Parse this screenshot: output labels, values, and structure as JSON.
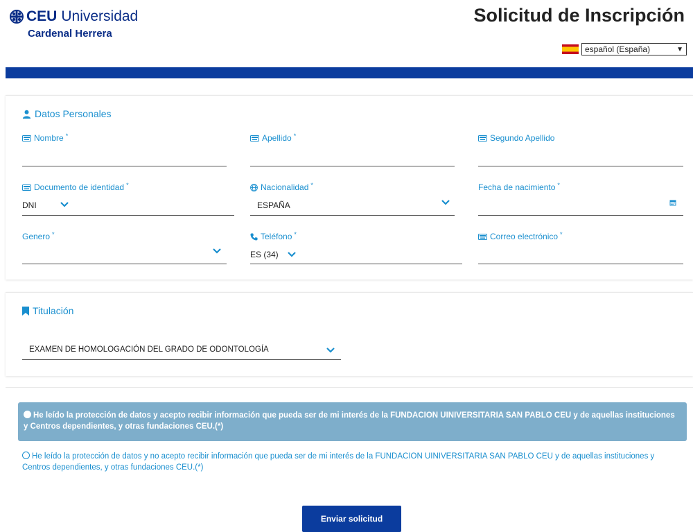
{
  "header": {
    "logo_ceu": "CEU",
    "logo_universidad": "Universidad",
    "logo_subtitle": "Cardenal Herrera",
    "title": "Solicitud de Inscripción",
    "language": "español (España)"
  },
  "personal": {
    "section_title": "Datos Personales",
    "nombre_label": "Nombre",
    "apellido_label": "Apellido",
    "segundo_apellido_label": "Segundo Apellido",
    "documento_label": "Documento de identidad",
    "documento_value": "DNI",
    "nacionalidad_label": "Nacionalidad",
    "nacionalidad_value": "ESPAÑA",
    "fecha_label": "Fecha de nacimiento",
    "genero_label": "Genero",
    "telefono_label": "Teléfono",
    "telefono_prefix": "ES (34)",
    "correo_label": "Correo electrónico",
    "required_mark": "*"
  },
  "titulacion": {
    "section_title": "Titulación",
    "value": "EXAMEN DE HOMOLOGACIÓN DEL GRADO DE ODONTOLOGÍA"
  },
  "consent": {
    "accept_text": "He leído la protección de datos y acepto recibir información que pueda ser de mi interés de la FUNDACION UINIVERSITARIA SAN PABLO CEU y de aquellas instituciones y Centros dependientes, y otras fundaciones CEU.(*)",
    "reject_text": "He leído la protección de datos y no acepto recibir información que pueda ser de mi interés de la FUNDACION UINIVERSITARIA SAN PABLO CEU y de aquellas instituciones y Centros dependientes, y otras fundaciones CEU.(*)"
  },
  "submit_label": "Enviar solicitud",
  "colors": {
    "brand_blue": "#0b3c9e",
    "accent": "#1a8fcf",
    "consent_bg": "#7eaecb"
  },
  "icons": [
    "user-icon",
    "keyboard-icon",
    "globe-icon",
    "phone-icon",
    "calendar-icon",
    "bookmark-icon",
    "chevron-down-icon"
  ]
}
